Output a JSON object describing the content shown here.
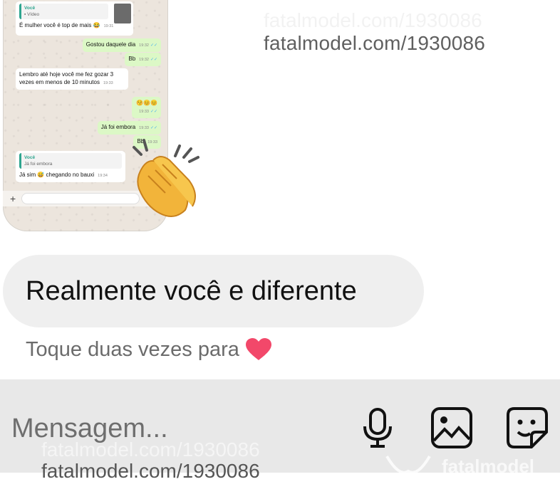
{
  "watermark": {
    "url": "fatalmodel.com/1930086",
    "brand": "fatalmodel"
  },
  "screenshot_chat": {
    "messages": [
      {
        "quote_author": "Você",
        "quote_text": "Vídeo",
        "text": "É mulher você é top de mais 😂",
        "time": "19:31"
      },
      {
        "text": "Gostou daquele dia",
        "time": "19:32"
      },
      {
        "text": "Bb",
        "time": "19:32"
      },
      {
        "text": "Lembro até hoje você me fez gozar 3 vezes em menos de 10 minutos",
        "time": "19:33"
      },
      {
        "text": "😚😊😊",
        "time": "19:33"
      },
      {
        "text": "Já foi embora",
        "time": "19:33"
      },
      {
        "text": "Bb",
        "time": "19:33"
      },
      {
        "quote_author": "Você",
        "quote_text": "Já foi embora",
        "text": "Já sim 😅 chegando no bauxi",
        "time": "19:34"
      }
    ]
  },
  "message": {
    "text": "Realmente você e diferente"
  },
  "hint": {
    "text": "Toque duas vezes para",
    "emoji": "❤️"
  },
  "composer": {
    "placeholder": "Mensagem..."
  },
  "icons": {
    "mic": "microphone-icon",
    "gallery": "image-icon",
    "sticker": "sticker-icon",
    "reaction": "clapping-hands-icon"
  },
  "colors": {
    "bubble_gray": "#efefef",
    "composer_bg": "#e8e8e8",
    "whatsapp_out": "#dcf8c6",
    "whatsapp_bg": "#ece5dd"
  }
}
